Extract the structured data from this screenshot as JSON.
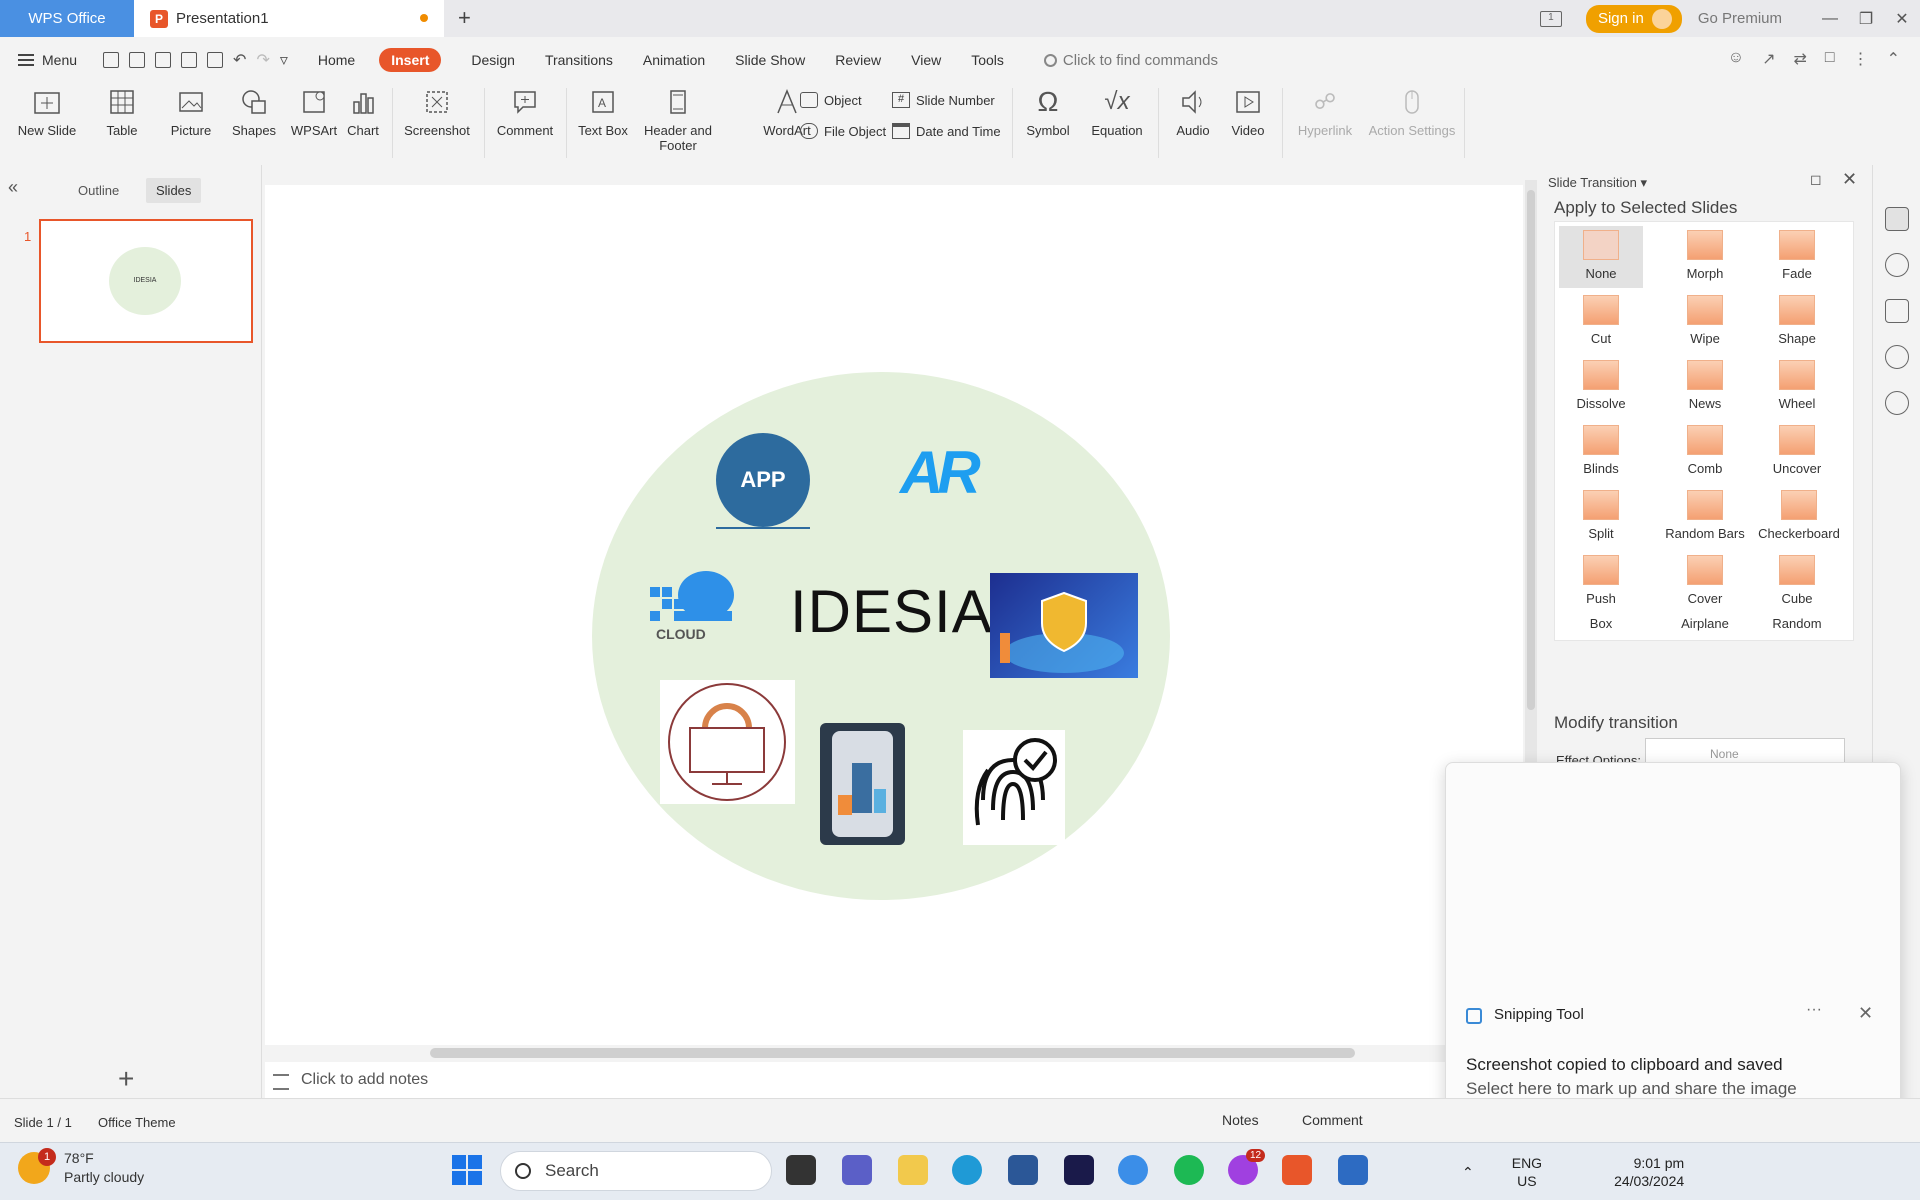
{
  "titlebar": {
    "app_tab": "WPS Office",
    "doc_tab": "Presentation1",
    "new_tab": "+",
    "sign_in": "Sign in",
    "go_premium": "Go Premium",
    "page_badge": "1"
  },
  "menu": {
    "menu_label": "Menu",
    "tabs": [
      "Home",
      "Insert",
      "Design",
      "Transitions",
      "Animation",
      "Slide Show",
      "Review",
      "View",
      "Tools"
    ],
    "active_tab": "Insert",
    "find_commands": "Click to find commands"
  },
  "ribbon": {
    "new_slide": "New Slide",
    "table": "Table",
    "picture": "Picture",
    "shapes": "Shapes",
    "wpsart": "WPSArt",
    "chart": "Chart",
    "screenshot": "Screenshot",
    "comment": "Comment",
    "text_box": "Text Box",
    "header_footer_1": "Header and",
    "header_footer_2": "Footer",
    "wordart": "WordArt",
    "object": "Object",
    "file_object": "File Object",
    "slide_number": "Slide Number",
    "date_time": "Date and Time",
    "symbol": "Symbol",
    "equation": "Equation",
    "audio": "Audio",
    "video": "Video",
    "hyperlink": "Hyperlink",
    "action_settings": "Action Settings"
  },
  "left_panel": {
    "outline_tab": "Outline",
    "slides_tab": "Slides",
    "slide_number": "1",
    "thumb_text": "IDESIA"
  },
  "slide": {
    "title_text": "IDESIA",
    "app_icon_text": "APP",
    "ar_logo_text": "AR",
    "cloud_text": "CLOUD",
    "notes_placeholder": "Click to add notes"
  },
  "transition_panel": {
    "title": "Slide Transition",
    "apply_label": "Apply to Selected Slides",
    "items": [
      "None",
      "Morph",
      "Fade",
      "Cut",
      "Wipe",
      "Shape",
      "Dissolve",
      "News",
      "Wheel",
      "Blinds",
      "Comb",
      "Uncover",
      "Split",
      "Random Bars",
      "Checkerboard",
      "Push",
      "Cover",
      "Cube",
      "Box",
      "Airplane",
      "Random"
    ],
    "selected": "None",
    "modify_label": "Modify transition",
    "effect_options_label": "Effect Options:",
    "effect_options_value": "None"
  },
  "notification": {
    "app_name": "Snipping Tool",
    "more": "···",
    "heading": "Screenshot copied to clipboard and saved",
    "subtext": "Select here to mark up and share the image"
  },
  "statusbar": {
    "slide_info": "Slide 1 / 1",
    "theme": "Office Theme",
    "notes": "Notes",
    "comment": "Comment"
  },
  "taskbar": {
    "weather_temp": "78°F",
    "weather_desc": "Partly cloudy",
    "weather_badge": "1",
    "search_placeholder": "Search",
    "messenger_badge": "12",
    "lang_1": "ENG",
    "lang_2": "US",
    "time": "9:01 pm",
    "date": "24/03/2024"
  },
  "colors": {
    "accent": "#e8562a",
    "wps_blue": "#4a90e2",
    "circle_green": "#e4f0dc"
  }
}
